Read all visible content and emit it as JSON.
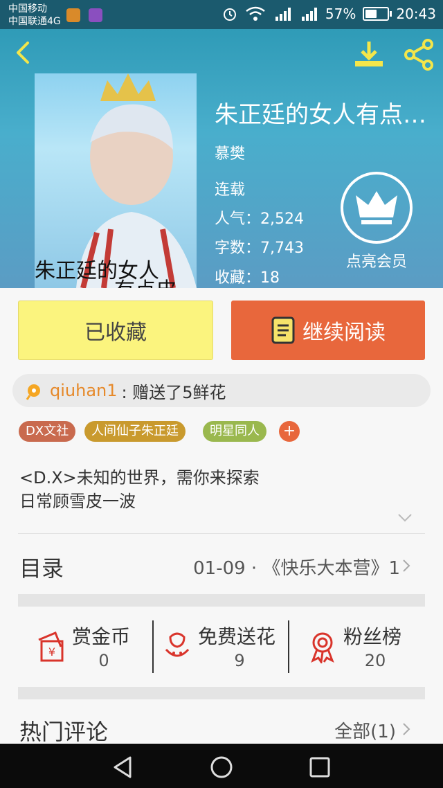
{
  "status_bar": {
    "carrier1": "中国移动",
    "carrier2": "中国联通4G",
    "battery_percent": "57%",
    "battery_level": 0.57,
    "time": "20:43",
    "icons": [
      "alarm-icon",
      "wifi-icon",
      "signal-2g-icon",
      "signal-4g-icon",
      "battery-icon"
    ]
  },
  "header": {
    "back_icon": "back-arrow-icon",
    "download_icon": "download-icon",
    "share_icon": "share-icon"
  },
  "book": {
    "cover_text_line1": "朱正廷的女人",
    "cover_text_line2": "有点皮",
    "title": "朱正廷的女人有点…",
    "author": "慕樊",
    "status": "连载",
    "popularity_label": "人气：",
    "popularity": "2,524",
    "words_label": "字数：",
    "words": "7,743",
    "favorites_label": "收藏：",
    "favorites": "18"
  },
  "vip": {
    "label": "点亮会员",
    "icon": "crown-icon"
  },
  "actions": {
    "favorited_label": "已收藏",
    "continue_label": "继续阅读",
    "continue_icon": "book-icon"
  },
  "gift_notice": {
    "icon": "flower-icon",
    "user": "qiuhan1",
    "message": ": 赠送了5鲜花"
  },
  "tags": [
    {
      "label": "DX文社",
      "color": "#c96a4e"
    },
    {
      "label": "人间仙子朱正廷",
      "color": "#c99a2e"
    },
    {
      "label": "明星同人",
      "color": "#9ab84e"
    }
  ],
  "tag_add_label": "+",
  "description": {
    "line1": "<D.X>未知的世界，需你来探索",
    "line2": "日常顾雪皮一波"
  },
  "catalog": {
    "title": "目录",
    "latest": "01-09 · 《快乐大本营》1"
  },
  "stats": [
    {
      "label": "赏金币",
      "value": "0",
      "icon": "red-envelope-icon"
    },
    {
      "label": "免费送花",
      "value": "9",
      "icon": "flower-pot-icon"
    },
    {
      "label": "粉丝榜",
      "value": "20",
      "icon": "medal-icon"
    }
  ],
  "comments": {
    "title": "热门评论",
    "all_label": "全部(1)"
  },
  "colors": {
    "accent_orange": "#e8673c",
    "favorite_yellow": "#fbf47e",
    "header_teal": "#2f9bb7",
    "user_orange": "#e6892a"
  },
  "nav": {
    "back_icon": "nav-back-icon",
    "home_icon": "nav-home-icon",
    "recents_icon": "nav-recents-icon"
  }
}
